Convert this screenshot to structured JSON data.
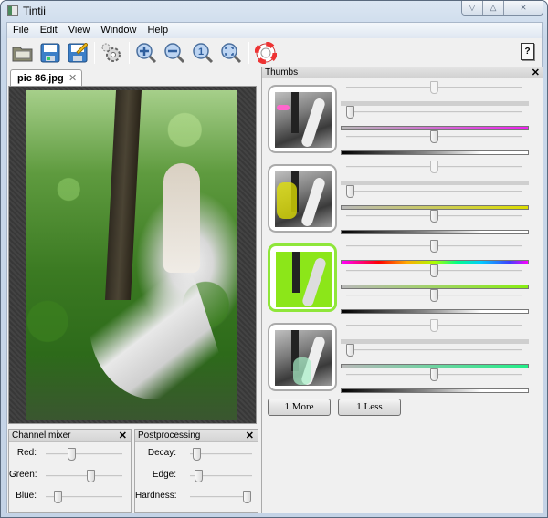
{
  "window": {
    "title": "Tintii",
    "controls": [
      "minimize",
      "maximize",
      "close"
    ]
  },
  "menu": [
    "File",
    "Edit",
    "View",
    "Window",
    "Help"
  ],
  "toolbar": {
    "buttons": [
      "open-icon",
      "save-icon",
      "save-as-icon",
      "settings-icon",
      "zoom-in-icon",
      "zoom-out-icon",
      "zoom-actual-icon",
      "zoom-fit-icon",
      "help-lifebuoy-icon"
    ],
    "whats_this": "?"
  },
  "document_tab": {
    "label": "pic 86.jpg",
    "close": "✕"
  },
  "channel_mixer": {
    "title": "Channel mixer",
    "close": "✕",
    "sliders": [
      {
        "label": "Red:",
        "value": 0.33
      },
      {
        "label": "Green:",
        "value": 0.58
      },
      {
        "label": "Blue:",
        "value": 0.15
      }
    ]
  },
  "postprocessing": {
    "title": "Postprocessing",
    "close": "✕",
    "sliders": [
      {
        "label": "Decay:",
        "value": 0.1
      },
      {
        "label": "Edge:",
        "value": 0.13
      },
      {
        "label": "Hardness:",
        "value": 1.0
      }
    ]
  },
  "thumbs": {
    "title": "Thumbs",
    "close": "✕",
    "items": [
      {
        "name": "thumb-magenta",
        "active": false,
        "hue": {
          "value": 0.5,
          "enabled": false
        },
        "saturation": {
          "value": 0.02,
          "color": "#ee22ee"
        },
        "lightness": {
          "value": 0.5
        },
        "tint": "#ff66cc"
      },
      {
        "name": "thumb-yellow",
        "active": false,
        "hue": {
          "value": 0.5,
          "enabled": false
        },
        "saturation": {
          "value": 0.02,
          "color": "#dddd00"
        },
        "lightness": {
          "value": 0.5
        },
        "tint": "#e4e400"
      },
      {
        "name": "thumb-green",
        "active": true,
        "hue": {
          "value": 0.5,
          "enabled": true
        },
        "saturation": {
          "value": 0.5,
          "color": "#88ee11"
        },
        "lightness": {
          "value": 0.5
        },
        "tint": "#8ce619"
      },
      {
        "name": "thumb-teal",
        "active": false,
        "hue": {
          "value": 0.5,
          "enabled": false
        },
        "saturation": {
          "value": 0.02,
          "color": "#22ee88"
        },
        "lightness": {
          "value": 0.5
        },
        "tint": "#a8f0c8"
      }
    ],
    "more_button": "1 More",
    "less_button": "1 Less"
  },
  "colors": {
    "active_border": "#8fe63a"
  }
}
